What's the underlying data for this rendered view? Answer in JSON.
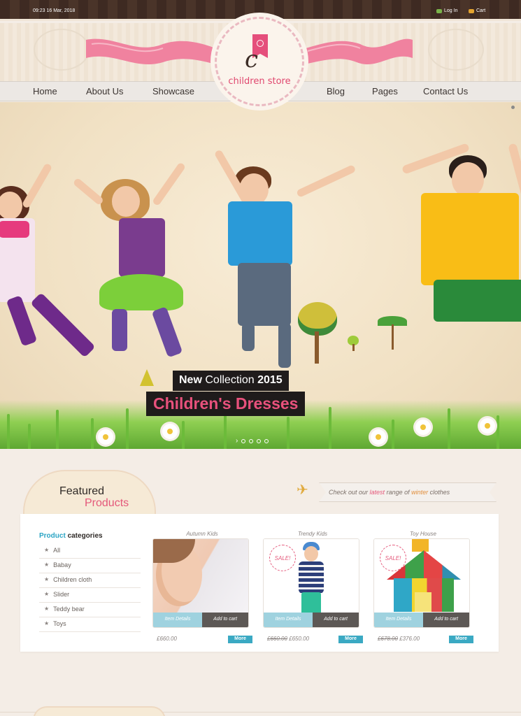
{
  "topbar": {
    "datetime": "09:23 16 Mar, 2018",
    "login": "Log In",
    "cart": "Cart"
  },
  "logo": {
    "text": "children store",
    "mark": "c"
  },
  "nav": {
    "items": [
      "Home",
      "About Us",
      "Showcase",
      "Blog",
      "Pages",
      "Contact Us"
    ]
  },
  "hero": {
    "caption_new": "New",
    "caption_collection": "Collection",
    "caption_year": "2015",
    "caption_main": "Children's Dresses",
    "slide_count": 4
  },
  "featured": {
    "title_line1": "Featured",
    "title_line2": "Products",
    "promo_pre": "Check out our",
    "promo_latest": "latest",
    "promo_mid": "range of",
    "promo_winter": "winter",
    "promo_post": "clothes"
  },
  "categories": {
    "title_blue": "Product",
    "title_rest": "categories",
    "items": [
      "All",
      "Babay",
      "Children cloth",
      "Slider",
      "Teddy bear",
      "Toys"
    ]
  },
  "products": [
    {
      "name": "Autumn Kids",
      "price": "£660.00",
      "old_price": "",
      "sale": "",
      "details": "Item Details",
      "cart": "Add to cart",
      "more": "More"
    },
    {
      "name": "Trendy Kids",
      "price": "£650.00",
      "old_price": "£660.00",
      "sale": "SALE!",
      "details": "Item Details",
      "cart": "Add to cart",
      "more": "More"
    },
    {
      "name": "Toy House",
      "price": "£376.00",
      "old_price": "£678.00",
      "sale": "SALE!",
      "details": "Item Details",
      "cart": "Add to cart",
      "more": "More"
    }
  ],
  "colors": {
    "accent_pink": "#e4587a",
    "accent_blue": "#3aa9c3",
    "topbar": "#3e2a22"
  }
}
